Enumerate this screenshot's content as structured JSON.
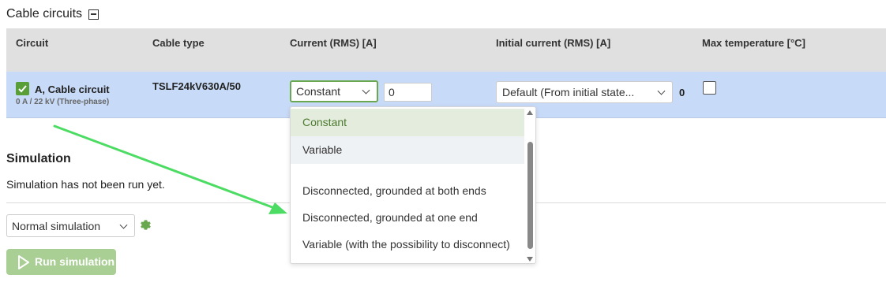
{
  "cable_section": {
    "title": "Cable circuits",
    "columns": [
      "Circuit",
      "Cable type",
      "Current (RMS) [A]",
      "Initial current (RMS) [A]",
      "Max temperature [°C]"
    ],
    "row": {
      "circuit_name": "A, Cable circuit",
      "circuit_sub": "0 A / 22 kV (Three-phase)",
      "cable_type": "TSLF24kV630A/50",
      "current_mode": "Constant",
      "current_value": "0",
      "initial_current": "Default (From initial state...",
      "initial_value": "0",
      "enabled": true,
      "max_temperature_checked": false
    }
  },
  "current_dropdown": {
    "options": [
      "Constant",
      "Variable",
      "Disconnected, grounded at both ends",
      "Disconnected, grounded at one end",
      "Variable (with the possibility to disconnect)"
    ],
    "selected": "Constant",
    "hovered": "Variable"
  },
  "simulation": {
    "title": "Simulation",
    "status": "Simulation has not been run yet.",
    "mode": "Normal simulation",
    "run_label": "Run simulation"
  },
  "colors": {
    "accent_green": "#6aa84f",
    "row_highlight": "#c7daf7",
    "header_gray": "#e0e0e0",
    "arrow_green": "#4ddc63"
  },
  "icons": [
    "collapse-icon",
    "checkbox-checked-icon",
    "chevron-down-icon",
    "gear-icon",
    "play-icon",
    "scroll-up-icon",
    "scroll-down-icon"
  ]
}
